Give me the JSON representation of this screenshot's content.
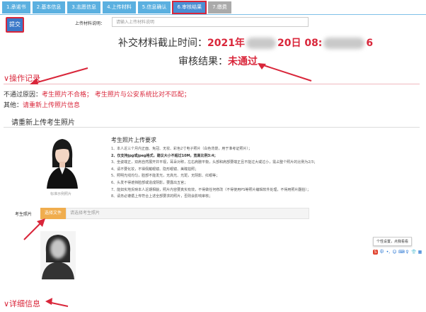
{
  "steps": [
    {
      "label": "1.承诺书"
    },
    {
      "label": "2.基本信息"
    },
    {
      "label": "3.志愿信息"
    },
    {
      "label": "4.上传材料"
    },
    {
      "label": "5.信息确认"
    },
    {
      "label": "6.审核结果"
    },
    {
      "label": "7.缴费"
    }
  ],
  "submit_label": "提交",
  "upload_note": {
    "label": "上传材料说明：",
    "placeholder": "请输入上传材料说明"
  },
  "deadline": {
    "label": "补交材料截止时间：",
    "value_prefix": "2021年",
    "value_mid": "20日 08:",
    "value_suffix": "6"
  },
  "result": {
    "label": "审核结果：",
    "value": "未通过"
  },
  "operation_record": {
    "title": "∨操作记录",
    "reason_label": "不通过原因：",
    "reason_value": "考生照片不合格；  考生照片与公安系统比对不匹配；",
    "other_label": "其他：",
    "other_value": "请重新上传照片信息"
  },
  "reupload": {
    "title": "请重新上传考生照片",
    "sample_caption": "标准示例照片",
    "req_title": "考生照片上传要求",
    "requirements": [
      {
        "text": "1、本人近三个月内正面、免冠、无妆、彩色2寸电子照片（白色背景，用于准考证照片）；",
        "bold": false
      },
      {
        "text": "2、仅支持jpg或jpeg格式，建议大小不超过10M，宽高比例3:4；",
        "bold": true
      },
      {
        "text": "3、坐姿端正，双肩自然展开并平视，耳朵对称，左右肩膀平衡，头部和肩部要端正且不能过大或过小，需占整个照片的比例为2/3；",
        "bold": false
      },
      {
        "text": "4、请不要化妆，不得佩戴眼镜、隐形眼镜、美瞳拍照；",
        "bold": false
      },
      {
        "text": "5、照明光线均匀，脸部不能发光，无高光、光斑，无阴影、红眼等；",
        "bold": false
      },
      {
        "text": "6、头发不得遮挡脸部或造成阴影，要露出五官；",
        "bold": false
      },
      {
        "text": "7、能如实地反映本人近期相貌，照片内容要真实有效，不得做任何修改（不得使用PS等照片编辑软件处理，不得用照片翻拍）；",
        "bold": false
      },
      {
        "text": "8、请务必遵循上传符合上述全部要求的照片，否则会影响审核；",
        "bold": false
      }
    ],
    "photo_label": "考生照片",
    "file_button": "选择文件",
    "file_placeholder": "请选择考生照片"
  },
  "tooltip": "个性设置，点我看看",
  "ime_icons": [
    "S",
    "中",
    "•,",
    "☺",
    "⌨",
    "♀",
    "👕",
    "▦"
  ],
  "detail": {
    "title": "∨详细信息"
  },
  "colors": {
    "accent": "#d9263a",
    "tab": "#5bb0e0",
    "tab_active": "#4a8fd4",
    "file_btn": "#f0ad4e"
  }
}
